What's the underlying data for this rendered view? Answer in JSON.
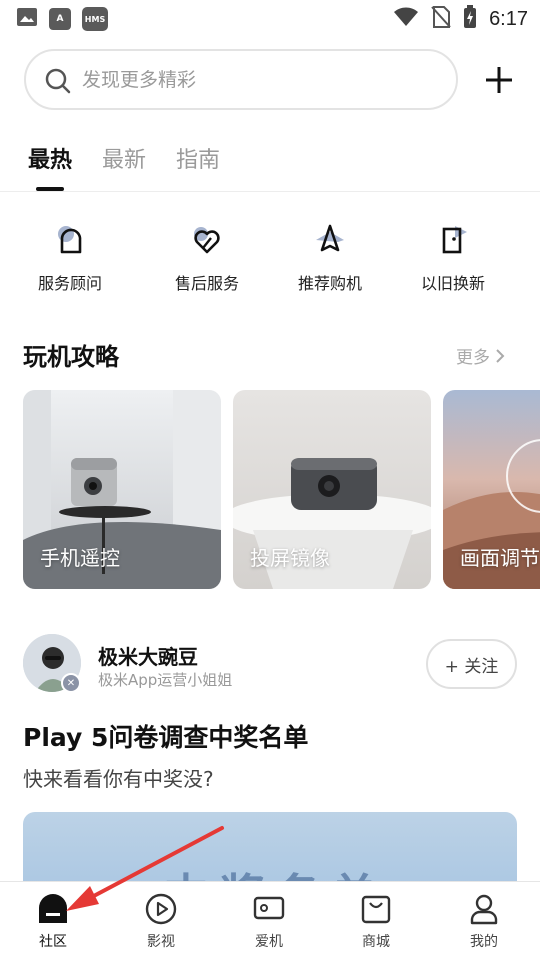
{
  "status_bar": {
    "left_icons": [
      "gallery-icon",
      "a-icon",
      "hms-icon"
    ],
    "a_label": "A",
    "hms_label": "HMS",
    "time": "6:17"
  },
  "search": {
    "placeholder": "发现更多精彩"
  },
  "tabs": [
    {
      "label": "最热",
      "active": true
    },
    {
      "label": "最新",
      "active": false
    },
    {
      "label": "指南",
      "active": false
    }
  ],
  "services": [
    {
      "label": "服务顾问",
      "icon": "advisor-icon"
    },
    {
      "label": "售后服务",
      "icon": "heart-service-icon"
    },
    {
      "label": "推荐购机",
      "icon": "rocket-icon"
    },
    {
      "label": "以旧换新",
      "icon": "trade-in-icon"
    }
  ],
  "guide_section": {
    "title": "玩机攻略",
    "more_label": "更多",
    "cards": [
      {
        "label": "手机遥控"
      },
      {
        "label": "投屏镜像"
      },
      {
        "label": "画面调节"
      }
    ]
  },
  "post": {
    "author_name": "极米大豌豆",
    "author_desc": "极米App运营小姐姐",
    "follow_label": "+ 关注",
    "title": "Play 5问卷调查中奖名单",
    "subtitle": "快来看看你有中奖没?",
    "image_text": "中奖名单"
  },
  "bottom_nav": [
    {
      "label": "社区",
      "icon": "home-icon",
      "active": true
    },
    {
      "label": "影视",
      "icon": "play-icon",
      "active": false
    },
    {
      "label": "爱机",
      "icon": "device-icon",
      "active": false
    },
    {
      "label": "商城",
      "icon": "shopping-bag-icon",
      "active": false
    },
    {
      "label": "我的",
      "icon": "profile-icon",
      "active": false
    }
  ],
  "colors": {
    "accent": "#111111",
    "muted": "#9a9a9a",
    "annotation": "#e53935"
  }
}
